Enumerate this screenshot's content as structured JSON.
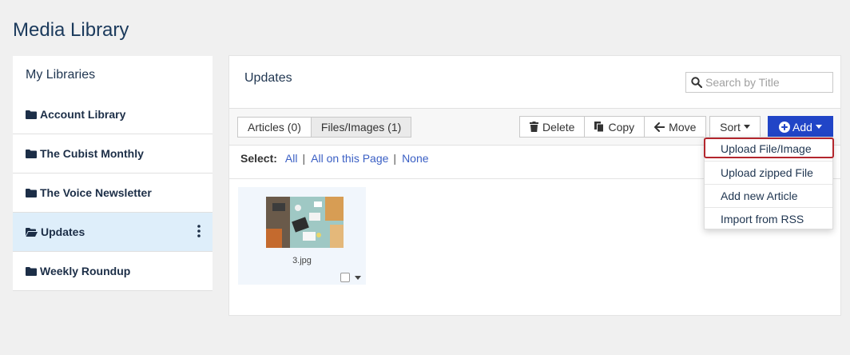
{
  "page": {
    "title": "Media Library"
  },
  "sidebar": {
    "heading": "My Libraries",
    "items": [
      {
        "label": "Account Library"
      },
      {
        "label": "The Cubist Monthly"
      },
      {
        "label": "The Voice Newsletter"
      },
      {
        "label": "Updates",
        "active": true
      },
      {
        "label": "Weekly Roundup"
      }
    ]
  },
  "main": {
    "folder_title": "Updates",
    "search": {
      "placeholder": "Search by Title",
      "value": ""
    },
    "tabs": [
      {
        "label": "Articles (0)"
      },
      {
        "label": "Files/Images (1)",
        "selected": true
      }
    ],
    "actions": {
      "delete": "Delete",
      "copy": "Copy",
      "move": "Move",
      "sort": "Sort",
      "add": "Add"
    },
    "select": {
      "label": "Select:",
      "all": "All",
      "all_on_page": "All on this Page",
      "none": "None",
      "separator": "|"
    },
    "files": [
      {
        "name": "3.jpg"
      }
    ],
    "add_menu": [
      {
        "label": "Upload File/Image"
      },
      {
        "label": "Upload zipped File"
      },
      {
        "label": "Add new Article"
      },
      {
        "label": "Import from RSS"
      }
    ]
  },
  "colors": {
    "accent": "#2145c7",
    "active_item_bg": "#deeefa",
    "link": "#3a5fc4",
    "highlight_border": "#b3262d"
  },
  "icons": {
    "folder": "folder-icon",
    "folder_open": "folder-open-icon",
    "kebab": "kebab-menu-icon",
    "search": "search-icon",
    "trash": "trash-icon",
    "copy": "copy-icon",
    "arrow_left": "arrow-left-icon",
    "plus_circle": "plus-circle-icon"
  }
}
